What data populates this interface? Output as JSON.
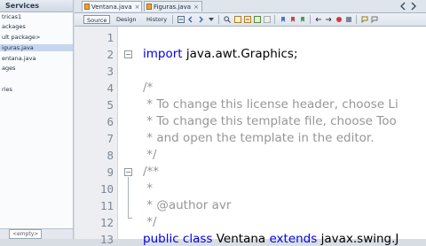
{
  "sidebar": {
    "title": "Services",
    "items": [
      "tricas1",
      "ackages",
      "ult package>",
      "iguras.java",
      "entana.java",
      "ages",
      "ries"
    ],
    "bottom_dropdown": "<empty>"
  },
  "tabs": [
    {
      "label": "Ventana.java",
      "close": "×",
      "active": true
    },
    {
      "label": "Figuras.java",
      "close": "×",
      "active": false
    }
  ],
  "toolbar": {
    "source_label": "Source",
    "design_label": "Design",
    "history_label": "History"
  },
  "editor": {
    "line_numbers": [
      "1",
      "2",
      "3",
      "4",
      "5",
      "6",
      "7",
      "8",
      "9",
      "10",
      "11",
      "12",
      "13"
    ],
    "line2": {
      "keyword": "import",
      "rest": " java.awt.Graphics;"
    },
    "comment1": [
      "/*",
      " * To change this license header, choose Li",
      " * To change this template file, choose Too",
      " * and open the template in the editor.",
      " */"
    ],
    "comment2": [
      "/**",
      " *",
      " * @author avr",
      " */"
    ],
    "line13": [
      "public",
      " ",
      "class",
      " Ventana ",
      "extends",
      " javax.swing.J"
    ]
  },
  "icons": [
    "file-icon",
    "back-icon",
    "forward-icon",
    "close-icon",
    "search-icon",
    "toggle-bookmark-icon",
    "comment-icon"
  ]
}
